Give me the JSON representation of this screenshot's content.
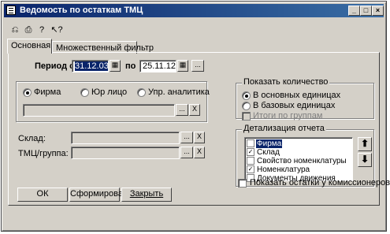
{
  "window": {
    "title": "Ведомость по остаткам ТМЦ",
    "buttons": {
      "minimize": "_",
      "maximize": "□",
      "close": "×"
    }
  },
  "toolbar": {
    "icons": [
      "report-settings-icon",
      "save-settings-icon",
      "help-icon",
      "context-help-icon"
    ],
    "glyphs": [
      "⎌",
      "⎙",
      "?",
      "↖?"
    ]
  },
  "tabs": [
    {
      "label": "Основная",
      "active": true
    },
    {
      "label": "Множественный фильтр",
      "active": false
    }
  ],
  "period": {
    "label_from": "Период с",
    "from_value": "31.12.03",
    "label_to": "по",
    "to_value": "25.11.12",
    "more_button": "..."
  },
  "company": {
    "options": [
      "Фирма",
      "Юр лицо",
      "Упр. аналитика"
    ],
    "selected": "Фирма",
    "value": "",
    "choose_button": "...",
    "clear_button": "X"
  },
  "warehouse": {
    "label": "Склад:",
    "value": "",
    "choose_button": "...",
    "clear_button": "X"
  },
  "goods": {
    "label": "ТМЦ/группа:",
    "value": "",
    "choose_button": "...",
    "clear_button": "X"
  },
  "quantity": {
    "title": "Показать количество",
    "options": [
      "В основных единицах",
      "В базовых единицах"
    ],
    "selected": "В основных единицах",
    "group_totals_label": "Итоги по группам",
    "group_totals_checked": false
  },
  "detail": {
    "title": "Детализация отчета",
    "items": [
      {
        "label": "Фирма",
        "checked": false,
        "selected": true
      },
      {
        "label": "Склад",
        "checked": true,
        "selected": false
      },
      {
        "label": "Свойство номенклатуры",
        "checked": false,
        "selected": false
      },
      {
        "label": "Номенклатура",
        "checked": true,
        "selected": false
      },
      {
        "label": "Документы движения",
        "checked": false,
        "selected": false
      }
    ],
    "up_glyph": "⬆",
    "down_glyph": "⬇"
  },
  "commission": {
    "label": "Показать остатки у комиссионеров",
    "checked": false
  },
  "footer": {
    "ok": "ОК",
    "build": "Сформировать",
    "close": "Закрыть"
  }
}
